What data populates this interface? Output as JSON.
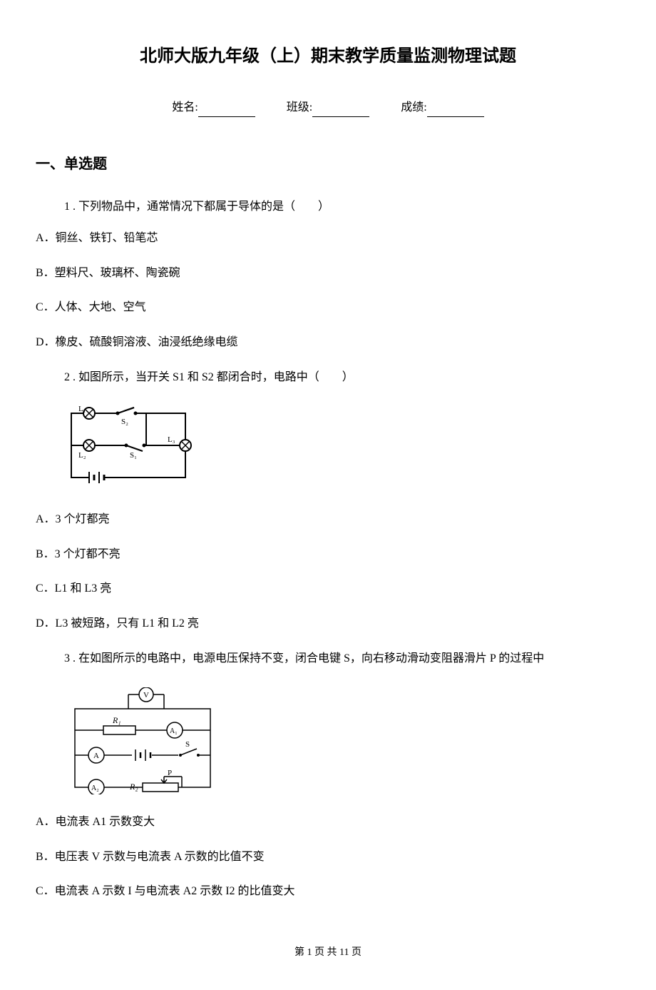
{
  "title": "北师大版九年级（上）期末教学质量监测物理试题",
  "info": {
    "name_label": "姓名:",
    "class_label": "班级:",
    "score_label": "成绩:"
  },
  "section1_title": "一、单选题",
  "q1": {
    "stem": "1 . 下列物品中，通常情况下都属于导体的是（　　）",
    "A": "A．铜丝、铁钉、铅笔芯",
    "B": "B．塑料尺、玻璃杯、陶瓷碗",
    "C": "C．人体、大地、空气",
    "D": "D．橡皮、硫酸铜溶液、油浸纸绝缘电缆"
  },
  "q2": {
    "stem": "2 . 如图所示，当开关 S1 和 S2 都闭合时，电路中（　　）",
    "diagram_labels": {
      "L1": "L₁",
      "L2": "L₂",
      "L3": "L₃",
      "S1": "S₁",
      "S2": "S₂"
    },
    "A": "A．3 个灯都亮",
    "B": "B．3 个灯都不亮",
    "C": "C．L1 和 L3 亮",
    "D": "D．L3 被短路，只有 L1 和 L2 亮"
  },
  "q3": {
    "stem": "3 . 在如图所示的电路中，电源电压保持不变，闭合电键 S，向右移动滑动变阻器滑片 P 的过程中",
    "diagram_labels": {
      "V": "V",
      "R1": "R₁",
      "R2": "R₂",
      "A": "A",
      "A1": "A₁",
      "A2": "A₂",
      "S": "S",
      "P": "P"
    },
    "A": "A．电流表 A1 示数变大",
    "B": "B．电压表 V 示数与电流表 A 示数的比值不变",
    "C": "C．电流表 A 示数 I 与电流表 A2 示数 I2  的比值变大"
  },
  "footer": "第 1 页 共 11 页"
}
